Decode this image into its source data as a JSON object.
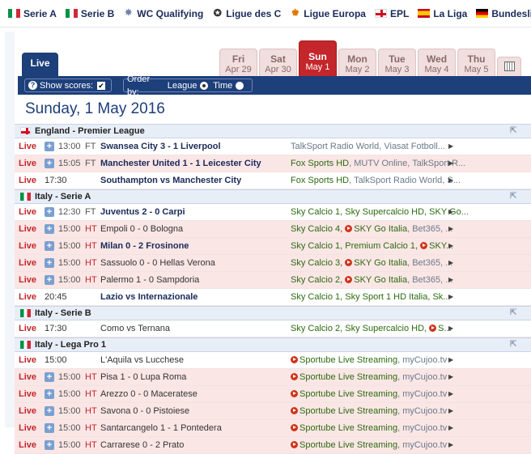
{
  "topnav": [
    {
      "label": "Serie A",
      "icon": "italy-flag"
    },
    {
      "label": "Serie B",
      "icon": "italy-flag"
    },
    {
      "label": "WC Qualifying",
      "icon": "world-cup-icon"
    },
    {
      "label": "Ligue des C",
      "icon": "champions-league-icon"
    },
    {
      "label": "Ligue Europa",
      "icon": "europa-league-icon"
    },
    {
      "label": "EPL",
      "icon": "england-flag"
    },
    {
      "label": "La Liga",
      "icon": "spain-flag"
    },
    {
      "label": "Bundesliga",
      "icon": "germany-flag"
    }
  ],
  "tabs": {
    "live": "Live",
    "days": [
      {
        "name": "Fri",
        "date": "Apr 29"
      },
      {
        "name": "Sat",
        "date": "Apr 30"
      },
      {
        "name": "Sun",
        "date": "May 1",
        "active": true
      },
      {
        "name": "Mon",
        "date": "May 2"
      },
      {
        "name": "Tue",
        "date": "May 3"
      },
      {
        "name": "Wed",
        "date": "May 4"
      },
      {
        "name": "Thu",
        "date": "May 5"
      }
    ],
    "calendar_icon": "calendar-icon"
  },
  "controls": {
    "show_scores": "Show scores:",
    "show_scores_checked": "✔",
    "order_by": "Order by:",
    "league": "League",
    "time": "Time"
  },
  "date_heading": "Sunday, 1 May 2016",
  "sections": [
    {
      "league": "England - Premier League",
      "rows": [
        {
          "live": "Live",
          "plus": "+",
          "time": "13:00",
          "status": "FT",
          "match": "Swansea City 3 - 1 Liverpool",
          "bold": true,
          "tv": [
            {
              "t": "TalkSport Radio World",
              "c": "gray"
            },
            {
              "t": ", ",
              "c": "sep"
            },
            {
              "t": "Viasat Fotboll...",
              "c": "gray"
            }
          ]
        },
        {
          "live": "Live",
          "plus": "+",
          "time": "15:05",
          "status": "FT",
          "match": "Manchester United 1 - 1 Leicester City",
          "bold": true,
          "pink": true,
          "tv": [
            {
              "t": "Fox Sports HD",
              "c": "green"
            },
            {
              "t": ", ",
              "c": "sep"
            },
            {
              "t": "MUTV Online",
              "c": "gray"
            },
            {
              "t": ", ",
              "c": "sep"
            },
            {
              "t": "TalkSport R...",
              "c": "gray"
            }
          ]
        },
        {
          "live": "Live",
          "time_plain": "17:30",
          "match": "Southampton vs Manchester City",
          "bold": true,
          "tv": [
            {
              "t": "Fox Sports HD",
              "c": "green"
            },
            {
              "t": ", ",
              "c": "sep"
            },
            {
              "t": "TalkSport Radio World",
              "c": "gray"
            },
            {
              "t": ", S...",
              "c": "gray"
            }
          ]
        }
      ]
    },
    {
      "league": "Italy - Serie A",
      "rows": [
        {
          "live": "Live",
          "plus": "+",
          "time": "12:30",
          "status": "FT",
          "match": "Juventus 2 - 0 Carpi",
          "bold": true,
          "tv": [
            {
              "t": "Sky Calcio 1, Sky Supercalcio HD, SKY Go...",
              "c": "green"
            }
          ]
        },
        {
          "live": "Live",
          "plus": "+",
          "time": "15:00",
          "status": "HT",
          "match": "Empoli 0 - 0 Bologna",
          "pink": true,
          "tv": [
            {
              "t": "Sky Calcio 4, ",
              "c": "green"
            },
            {
              "t": "SKY Go Italia",
              "c": "green",
              "play": true
            },
            {
              "t": ", ",
              "c": "sep"
            },
            {
              "t": "Bet365",
              "c": "gray"
            },
            {
              "t": ", ...",
              "c": "gray"
            }
          ]
        },
        {
          "live": "Live",
          "plus": "+",
          "time": "15:00",
          "status": "HT",
          "match": "Milan 0 - 2 Frosinone",
          "bold": true,
          "pink": true,
          "tv": [
            {
              "t": "Sky Calcio 1, Premium Calcio 1, ",
              "c": "green"
            },
            {
              "t": "SKY...",
              "c": "green",
              "play": true
            }
          ]
        },
        {
          "live": "Live",
          "plus": "+",
          "time": "15:00",
          "status": "HT",
          "match": "Sassuolo 0 - 0 Hellas Verona",
          "pink": true,
          "tv": [
            {
              "t": "Sky Calcio 3, ",
              "c": "green"
            },
            {
              "t": "SKY Go Italia",
              "c": "green",
              "play": true
            },
            {
              "t": ", ",
              "c": "sep"
            },
            {
              "t": "Bet365",
              "c": "gray"
            },
            {
              "t": ", ...",
              "c": "gray"
            }
          ]
        },
        {
          "live": "Live",
          "plus": "+",
          "time": "15:00",
          "status": "HT",
          "match": "Palermo 1 - 0 Sampdoria",
          "pink": true,
          "tv": [
            {
              "t": "Sky Calcio 2, ",
              "c": "green"
            },
            {
              "t": "SKY Go Italia",
              "c": "green",
              "play": true
            },
            {
              "t": ", ",
              "c": "sep"
            },
            {
              "t": "Bet365",
              "c": "gray"
            },
            {
              "t": ", ...",
              "c": "gray"
            }
          ]
        },
        {
          "live": "Live",
          "time_plain": "20:45",
          "match": "Lazio vs Internazionale",
          "bold": true,
          "tv": [
            {
              "t": "Sky Calcio 1, Sky Sport 1 HD Italia, Sk...",
              "c": "green"
            }
          ]
        }
      ]
    },
    {
      "league": "Italy - Serie B",
      "rows": [
        {
          "live": "Live",
          "time_plain": "17:30",
          "match": "Como vs Ternana",
          "tv": [
            {
              "t": "Sky Calcio 2, Sky Supercalcio HD, ",
              "c": "green"
            },
            {
              "t": "S...",
              "c": "green",
              "play": true
            }
          ]
        }
      ]
    },
    {
      "league": "Italy - Lega Pro 1",
      "rows": [
        {
          "live": "Live",
          "time_plain": "15:00",
          "match": "L'Aquila vs Lucchese",
          "tv": [
            {
              "t": "Sportube Live Streaming",
              "c": "green",
              "play": true
            },
            {
              "t": ", ",
              "c": "sep"
            },
            {
              "t": "myCujoo.tv",
              "c": "gray"
            }
          ]
        },
        {
          "live": "Live",
          "plus": "+",
          "time": "15:00",
          "status": "HT",
          "match": "Pisa 1 - 0 Lupa Roma",
          "pink": true,
          "tv": [
            {
              "t": "Sportube Live Streaming",
              "c": "green",
              "play": true
            },
            {
              "t": ", ",
              "c": "sep"
            },
            {
              "t": "myCujoo.tv",
              "c": "gray"
            }
          ]
        },
        {
          "live": "Live",
          "plus": "+",
          "time": "15:00",
          "status": "HT",
          "match": "Arezzo 0 - 0 Maceratese",
          "pink": true,
          "tv": [
            {
              "t": "Sportube Live Streaming",
              "c": "green",
              "play": true
            },
            {
              "t": ", ",
              "c": "sep"
            },
            {
              "t": "myCujoo.tv",
              "c": "gray"
            }
          ]
        },
        {
          "live": "Live",
          "plus": "+",
          "time": "15:00",
          "status": "HT",
          "match": "Savona 0 - 0 Pistoiese",
          "pink": true,
          "tv": [
            {
              "t": "Sportube Live Streaming",
              "c": "green",
              "play": true
            },
            {
              "t": ", ",
              "c": "sep"
            },
            {
              "t": "myCujoo.tv",
              "c": "gray"
            }
          ]
        },
        {
          "live": "Live",
          "plus": "+",
          "time": "15:00",
          "status": "HT",
          "match": "Santarcangelo 1 - 1 Pontedera",
          "pink": true,
          "tv": [
            {
              "t": "Sportube Live Streaming",
              "c": "green",
              "play": true
            },
            {
              "t": ", ",
              "c": "sep"
            },
            {
              "t": "myCujoo.tv",
              "c": "gray"
            }
          ]
        },
        {
          "live": "Live",
          "plus": "+",
          "time": "15:00",
          "status": "HT",
          "match": "Carrarese 0 - 2 Prato",
          "pink": true,
          "tv": [
            {
              "t": "Sportube Live Streaming",
              "c": "green",
              "play": true
            },
            {
              "t": ", ",
              "c": "sep"
            },
            {
              "t": "myCujoo.tv",
              "c": "gray"
            }
          ]
        }
      ]
    }
  ],
  "colors": {
    "navy": "#1d3f7a",
    "red": "#c3262b",
    "green": "#2b6b10",
    "pink_row": "#fbe6e6",
    "league_bg": "#e8eef7"
  }
}
